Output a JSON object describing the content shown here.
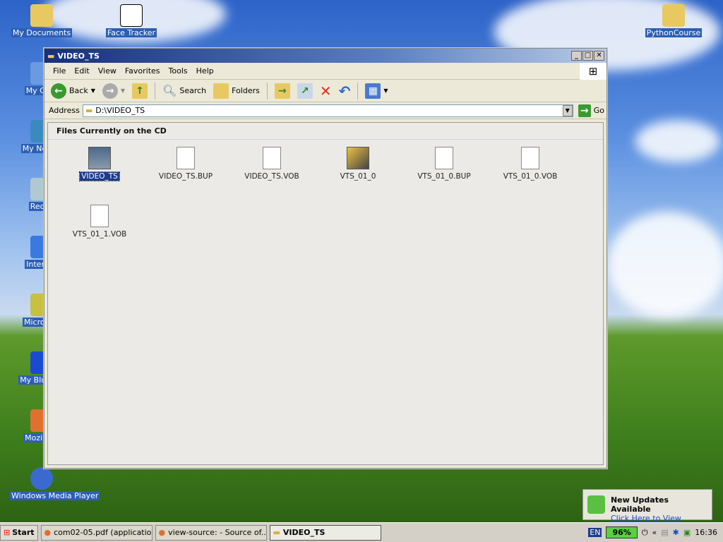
{
  "desktop": {
    "icons": [
      "My Documents",
      "Face Tracker",
      "PythonCourse",
      "My Com",
      "My Netwo",
      "Recyc",
      "Internet",
      "Microsoft",
      "My Bluetoo",
      "Mozilla F",
      "Windows Media Player"
    ]
  },
  "window": {
    "title": "VIDEO_TS",
    "menu": [
      "File",
      "Edit",
      "View",
      "Favorites",
      "Tools",
      "Help"
    ],
    "toolbar": {
      "back": "Back",
      "search": "Search",
      "folders": "Folders"
    },
    "address": {
      "label": "Address",
      "value": "D:\\VIDEO_TS",
      "go": "Go"
    },
    "section": "Files Currently on the CD",
    "files": [
      "VIDEO_TS",
      "VIDEO_TS.BUP",
      "VIDEO_TS.VOB",
      "VTS_01_0",
      "VTS_01_0.BUP",
      "VTS_01_0.VOB",
      "VTS_01_1.VOB"
    ]
  },
  "notification": {
    "title": "New Updates Available",
    "link": "Click Here to View"
  },
  "taskbar": {
    "start": "Start",
    "tasks": [
      "com02-05.pdf (applicatio...",
      "view-source: - Source of...",
      "VIDEO_TS"
    ],
    "lang": "EN",
    "battery": "96%",
    "clock": "16:36"
  }
}
